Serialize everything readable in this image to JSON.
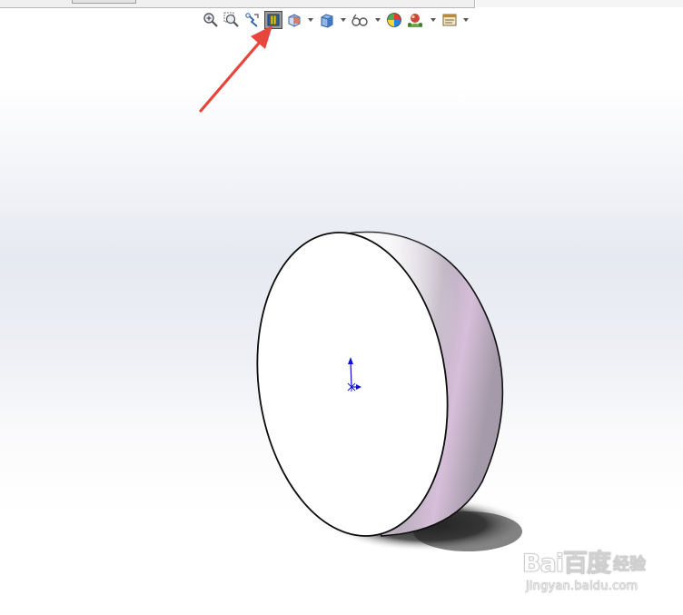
{
  "toolbar": {
    "tools": [
      {
        "icon": "zoom-to-fit-icon",
        "dropdown": false
      },
      {
        "icon": "zoom-to-area-icon",
        "dropdown": false
      },
      {
        "icon": "previous-view-icon",
        "dropdown": false
      },
      {
        "icon": "section-view-icon",
        "dropdown": false,
        "active": true
      },
      {
        "icon": "view-orientation-icon",
        "dropdown": true
      },
      {
        "icon": "display-style-icon",
        "dropdown": true
      },
      {
        "icon": "hide-show-items-icon",
        "dropdown": true
      },
      {
        "icon": "edit-appearance-icon",
        "dropdown": false
      },
      {
        "icon": "apply-scene-icon",
        "dropdown": true
      },
      {
        "icon": "view-settings-icon",
        "dropdown": true
      }
    ]
  },
  "annotation": {
    "arrow_color": "#e8453c",
    "points_to": "section-view-icon"
  },
  "model": {
    "shape": "hemisphere",
    "flat_face_color": "#ffffff",
    "curved_face_color": "#d9c4db",
    "origin_marker_color": "#1010cc"
  },
  "watermark": {
    "logo": "Bai百度",
    "product": "经验",
    "url": "jingyan.baidu.com"
  }
}
